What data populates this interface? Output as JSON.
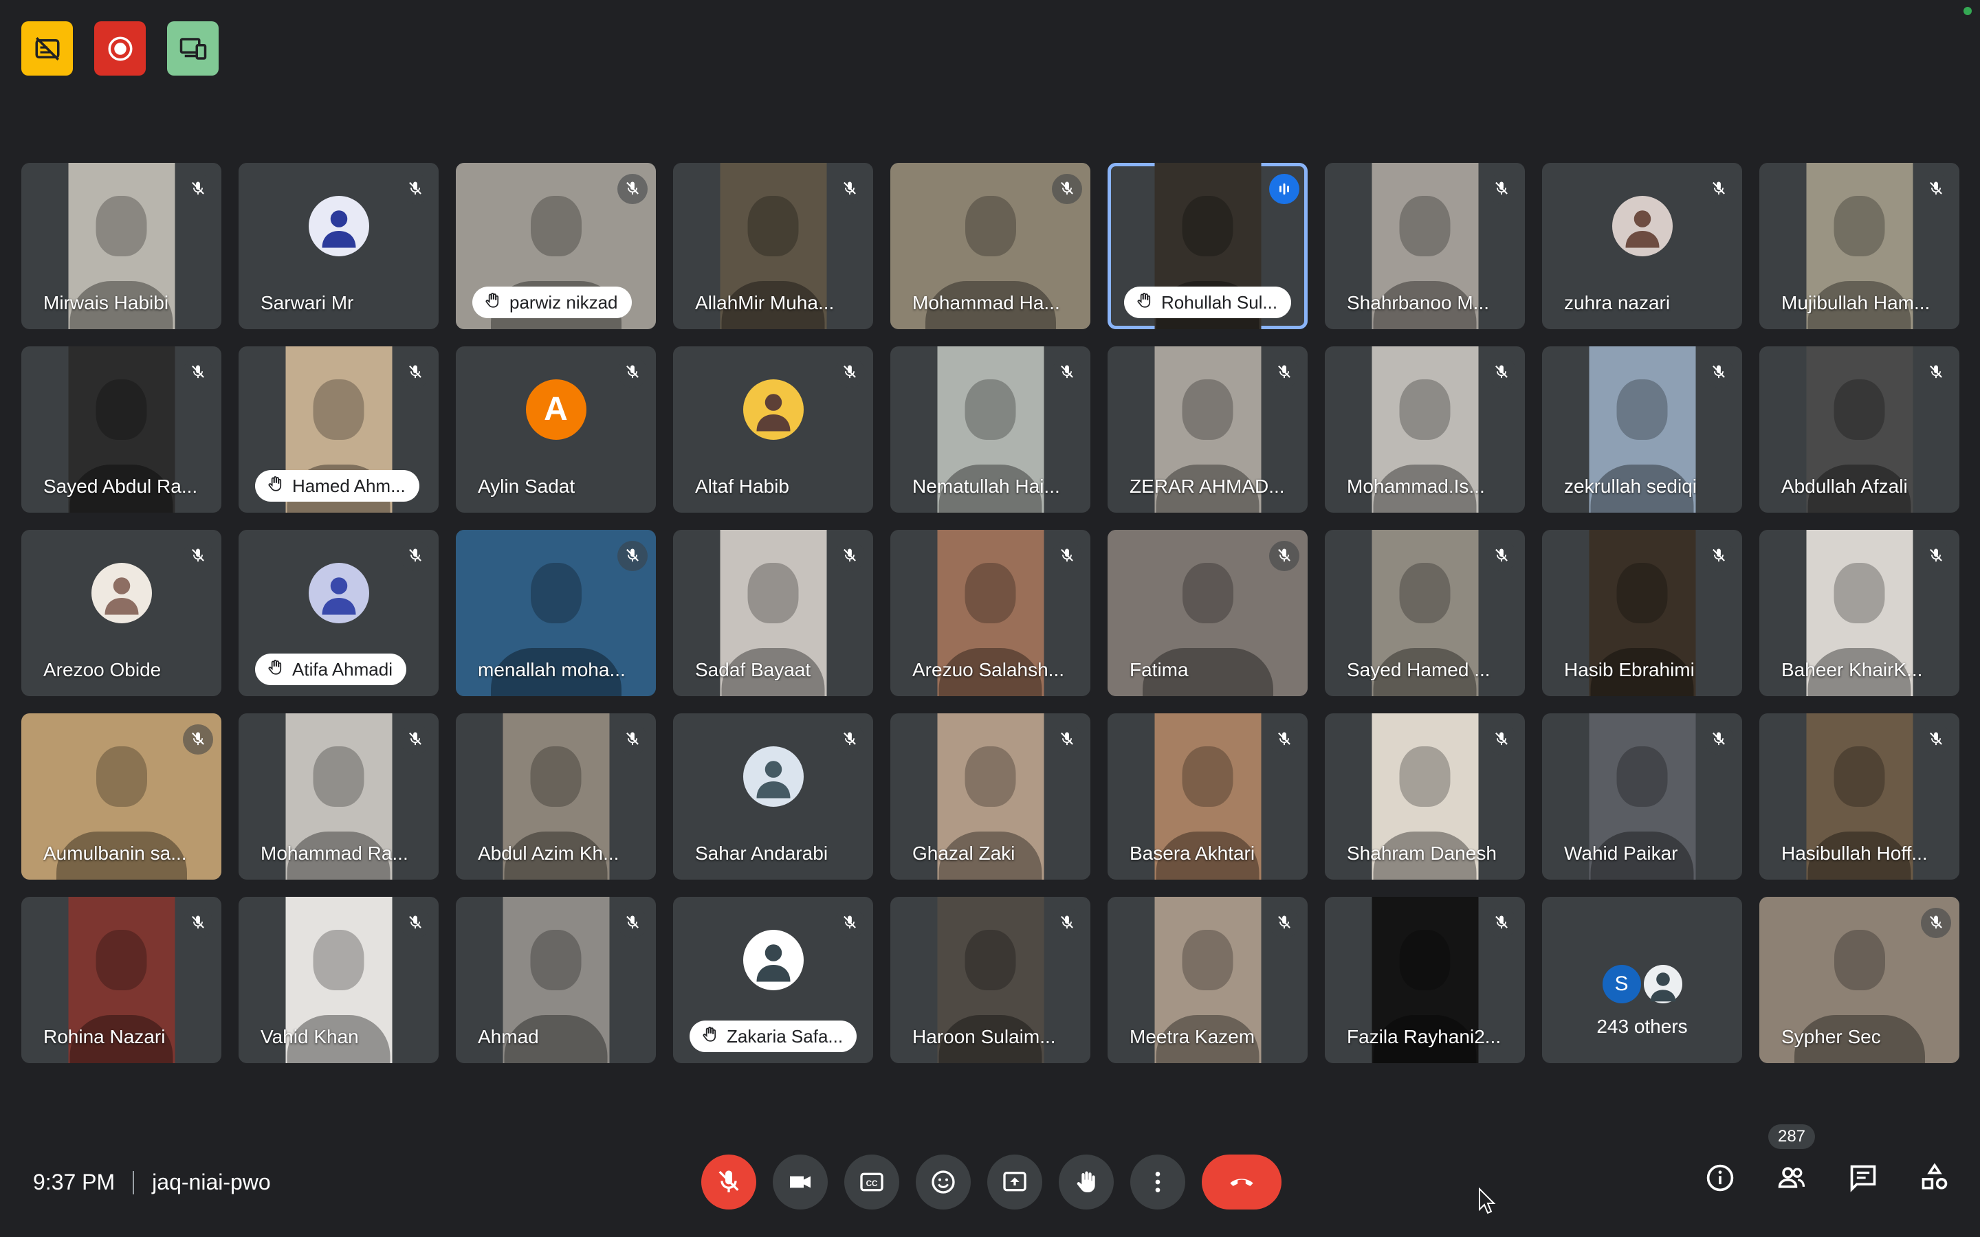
{
  "top_icons": [
    {
      "name": "captions-off-icon",
      "color": "#fbbc04"
    },
    {
      "name": "recording-icon",
      "color": "#d93025"
    },
    {
      "name": "companion-mode-icon",
      "color": "#81c995"
    }
  ],
  "participants": [
    {
      "name": "Mirwais Habibi",
      "kind": "video",
      "bg": "#b8b5ad",
      "muted": true
    },
    {
      "name": "Sarwari Mr",
      "kind": "avatar",
      "avatar_bg": "#e8eaf6",
      "avatar_fg": "#2b3a9b",
      "muted": true
    },
    {
      "name": "parwiz nikzad",
      "kind": "video-full",
      "bg": "#9c9891",
      "muted": true,
      "hand": true
    },
    {
      "name": "AllahMir Muha...",
      "kind": "video",
      "bg": "#5d5445",
      "muted": true
    },
    {
      "name": "Mohammad Ha...",
      "kind": "video-full",
      "bg": "#8b8270",
      "muted": true
    },
    {
      "name": "Rohullah Sul...",
      "kind": "video",
      "bg": "#35302a",
      "muted": false,
      "speaking": true,
      "hand": true
    },
    {
      "name": "Shahrbanoo M...",
      "kind": "video",
      "bg": "#a19c96",
      "muted": true
    },
    {
      "name": "zuhra nazari",
      "kind": "avatar",
      "avatar_bg": "#d7ccc8",
      "avatar_fg": "#6d4c41",
      "muted": true
    },
    {
      "name": "Mujibullah Ham...",
      "kind": "video",
      "bg": "#9a9483",
      "muted": true
    },
    {
      "name": "Sayed Abdul Ra...",
      "kind": "video",
      "bg": "#2c2c2c",
      "muted": true
    },
    {
      "name": "Hamed Ahm...",
      "kind": "video",
      "bg": "#c3ad8f",
      "muted": true,
      "hand": true
    },
    {
      "name": "Aylin Sadat",
      "kind": "avatar",
      "avatar_bg": "#f57c00",
      "avatar_fg": "#ffffff",
      "initial": "A",
      "muted": true
    },
    {
      "name": "Altaf Habib",
      "kind": "avatar",
      "avatar_bg": "#f4c542",
      "avatar_fg": "#5d4037",
      "muted": true
    },
    {
      "name": "Nematullah Hai...",
      "kind": "video",
      "bg": "#aeb3ae",
      "muted": true
    },
    {
      "name": "ZERAR AHMAD...",
      "kind": "video",
      "bg": "#a6a19a",
      "muted": true
    },
    {
      "name": "Mohammad.Is...",
      "kind": "video",
      "bg": "#bdbab5",
      "muted": true
    },
    {
      "name": "zekrullah sediqi",
      "kind": "video",
      "bg": "#8ea0b4",
      "muted": true
    },
    {
      "name": "Abdullah Afzali",
      "kind": "video",
      "bg": "#4a4a4a",
      "muted": true
    },
    {
      "name": "Arezoo Obide",
      "kind": "avatar",
      "avatar_bg": "#efe9e1",
      "avatar_fg": "#8d6e63",
      "muted": true
    },
    {
      "name": "Atifa Ahmadi",
      "kind": "avatar",
      "avatar_bg": "#c5cae9",
      "avatar_fg": "#3949ab",
      "muted": true,
      "hand": true
    },
    {
      "name": "menallah moha...",
      "kind": "video-full",
      "bg": "#2f5d83",
      "muted": true
    },
    {
      "name": "Sadaf Bayaat",
      "kind": "video",
      "bg": "#c7c2bd",
      "muted": true
    },
    {
      "name": "Arezuo Salahsh...",
      "kind": "video",
      "bg": "#9a6f58",
      "muted": true
    },
    {
      "name": "Fatima",
      "kind": "video-full",
      "bg": "#7c7570",
      "muted": true
    },
    {
      "name": "Sayed Hamed ...",
      "kind": "video",
      "bg": "#8f8a80",
      "muted": true
    },
    {
      "name": "Hasib Ebrahimi",
      "kind": "video",
      "bg": "#3a3026",
      "muted": true
    },
    {
      "name": "Baheer KhairK...",
      "kind": "video",
      "bg": "#d8d4cf",
      "muted": true
    },
    {
      "name": "Aumulbanin sa...",
      "kind": "video-full",
      "bg": "#b99a6e",
      "muted": true
    },
    {
      "name": "Mohammad Ra...",
      "kind": "video",
      "bg": "#c2bfba",
      "muted": true
    },
    {
      "name": "Abdul Azim Kh...",
      "kind": "video",
      "bg": "#8c8479",
      "muted": true
    },
    {
      "name": "Sahar Andarabi",
      "kind": "avatar",
      "avatar_bg": "#dbe4ee",
      "avatar_fg": "#455a64",
      "muted": true
    },
    {
      "name": "Ghazal Zaki",
      "kind": "video",
      "bg": "#b09a86",
      "muted": true
    },
    {
      "name": "Basera Akhtari",
      "kind": "video",
      "bg": "#a67f62",
      "muted": true
    },
    {
      "name": "Shahram Danesh",
      "kind": "video",
      "bg": "#ddd6cb",
      "muted": true
    },
    {
      "name": "Wahid Paikar",
      "kind": "video",
      "bg": "#5a5d63",
      "muted": true
    },
    {
      "name": "Hasibullah Hoff...",
      "kind": "video",
      "bg": "#6b5a46",
      "muted": true
    },
    {
      "name": "Rohina Nazari",
      "kind": "video",
      "bg": "#7d3630",
      "muted": true
    },
    {
      "name": "Vahid Khan",
      "kind": "video",
      "bg": "#e4e2df",
      "muted": true
    },
    {
      "name": "Ahmad",
      "kind": "video",
      "bg": "#8d8a86",
      "muted": true
    },
    {
      "name": "Zakaria Safa...",
      "kind": "avatar",
      "avatar_bg": "#ffffff",
      "avatar_fg": "#37474f",
      "muted": true,
      "hand": true
    },
    {
      "name": "Haroon Sulaim...",
      "kind": "video",
      "bg": "#4f4a44",
      "muted": true
    },
    {
      "name": "Meetra Kazem",
      "kind": "video",
      "bg": "#a49586",
      "muted": true
    },
    {
      "name": "Fazila Rayhani2...",
      "kind": "video",
      "bg": "#141414",
      "muted": true
    },
    {
      "name": "243 others",
      "kind": "others",
      "avatar_initial": "S",
      "avatar_bg": "#1565c0"
    },
    {
      "name": "Sypher Sec",
      "kind": "video-full",
      "bg": "#8d8174",
      "muted": true
    }
  ],
  "meeting": {
    "time": "9:37 PM",
    "code": "jaq-niai-pwo"
  },
  "controls": [
    {
      "name": "mic-off-button",
      "icon": "mic-off",
      "style": "red"
    },
    {
      "name": "camera-button",
      "icon": "camera",
      "style": "normal"
    },
    {
      "name": "captions-button",
      "icon": "cc",
      "style": "normal"
    },
    {
      "name": "emoji-button",
      "icon": "emoji",
      "style": "normal"
    },
    {
      "name": "present-button",
      "icon": "present",
      "style": "normal"
    },
    {
      "name": "raise-hand-button",
      "icon": "hand",
      "style": "normal"
    },
    {
      "name": "more-options-button",
      "icon": "more",
      "style": "normal"
    },
    {
      "name": "leave-call-button",
      "icon": "hangup",
      "style": "end"
    }
  ],
  "right_controls": {
    "people_count": "287",
    "items": [
      "info-icon",
      "people-icon",
      "chat-icon",
      "activities-icon"
    ]
  }
}
